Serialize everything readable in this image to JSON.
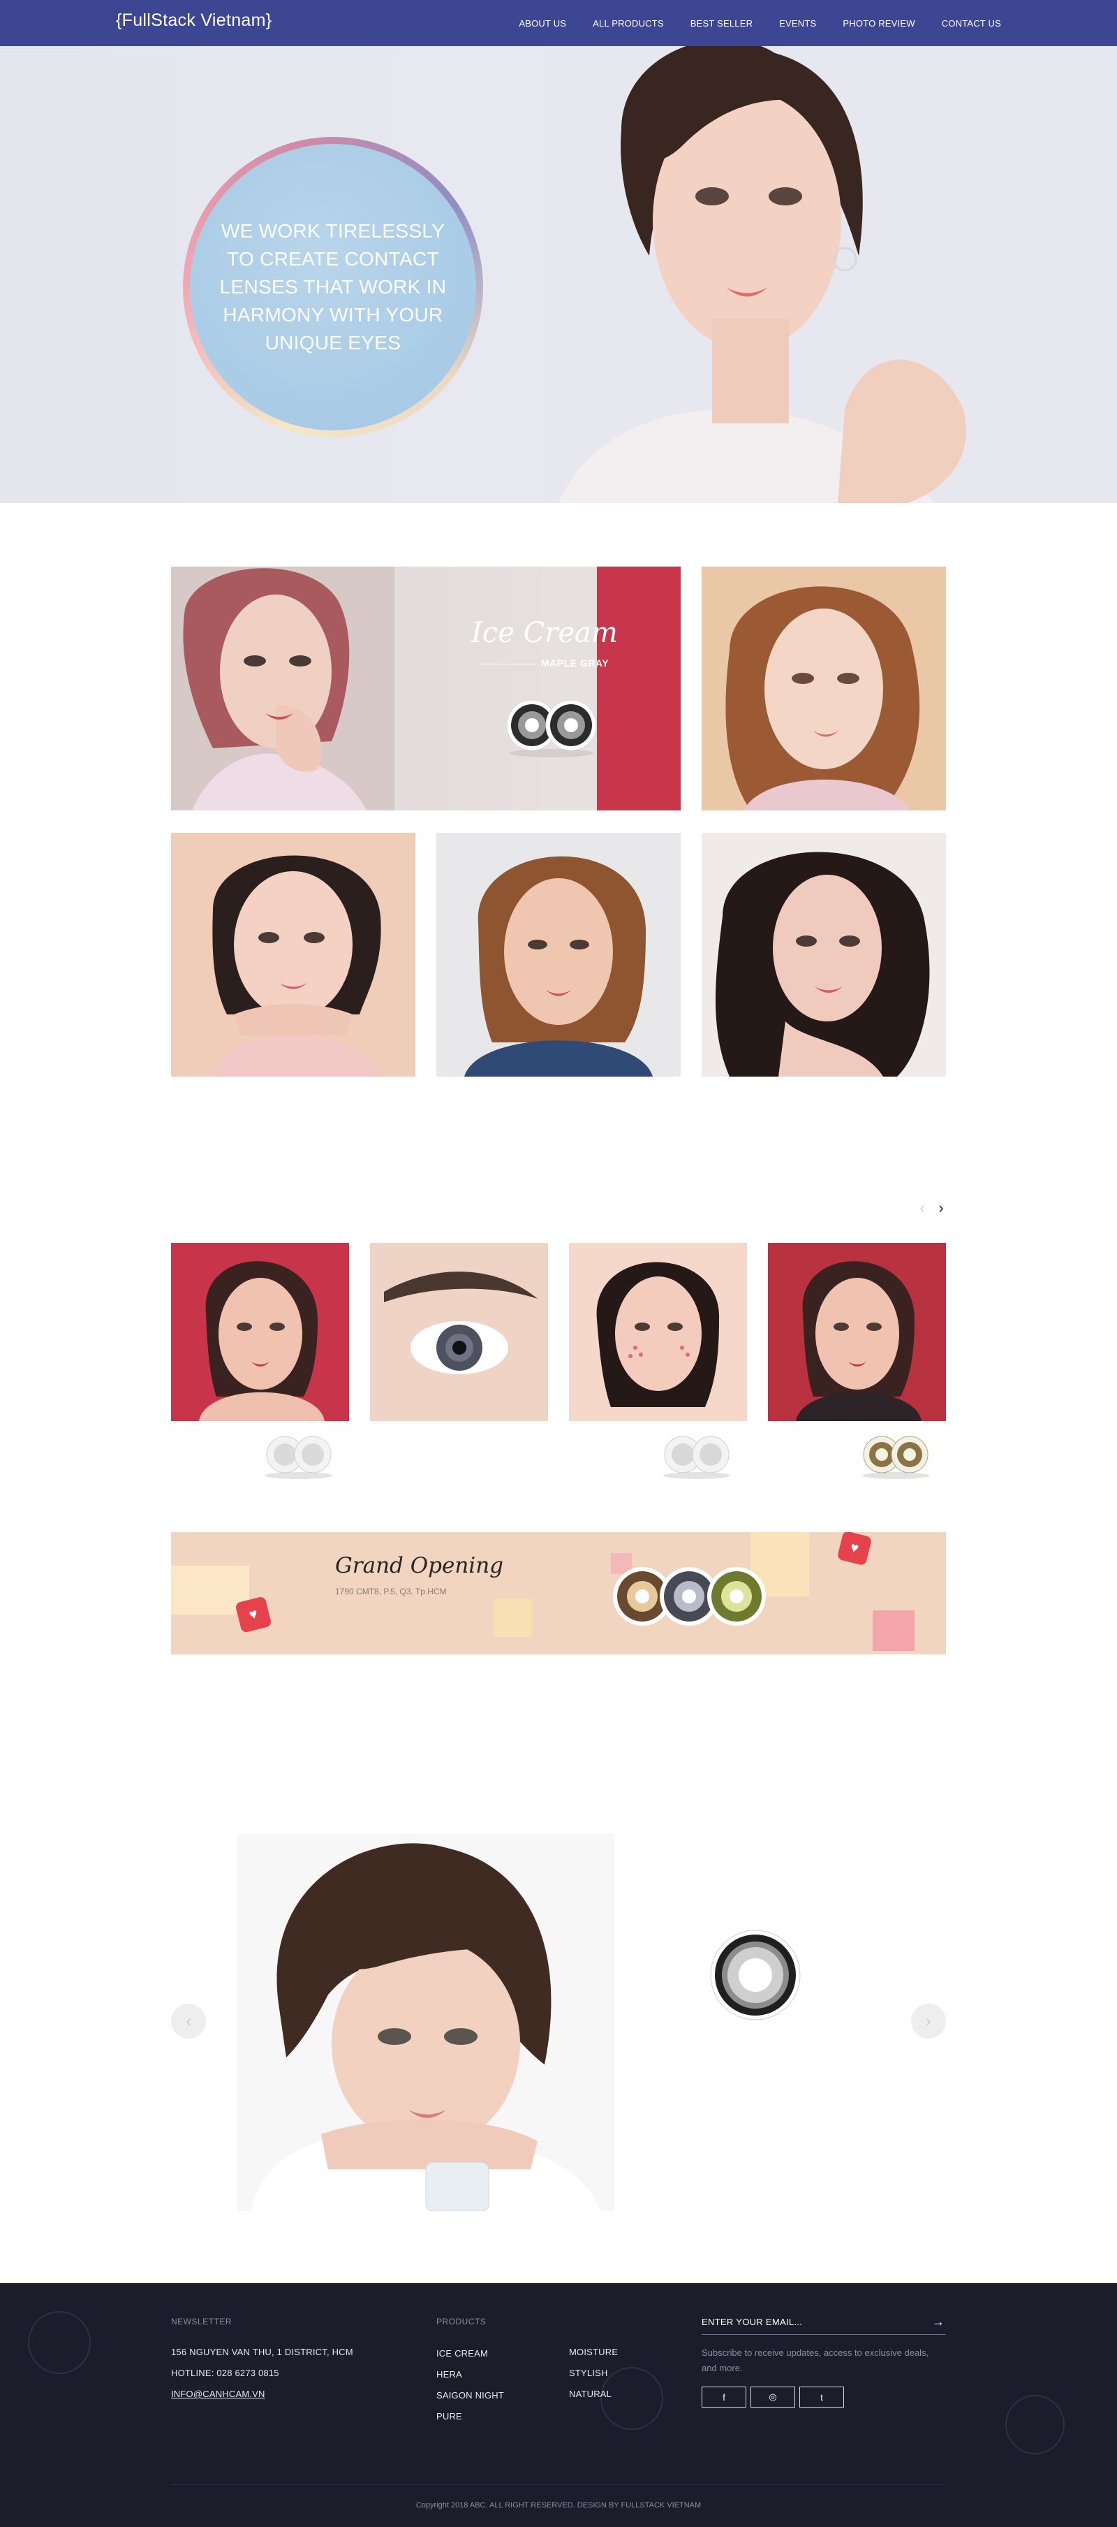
{
  "nav": {
    "logo": "{FullStack Vietnam}",
    "items": [
      "ABOUT US",
      "ALL PRODUCTS",
      "BEST SELLER",
      "EVENTS",
      "PHOTO REVIEW",
      "CONTACT US"
    ]
  },
  "hero": {
    "text": "WE WORK TIRELESSLY TO CREATE CONTACT LENSES THAT WORK IN HARMONY WITH YOUR UNIQUE EYES"
  },
  "feature": {
    "title": "Ice Cream",
    "subtitle": "MAPLE GRAY"
  },
  "banner": {
    "title": "Grand Opening",
    "address": "1790 CMT8, P.5, Q3. Tp.HCM"
  },
  "footer": {
    "newsletter_heading": "NEWSLETTER",
    "address": "156 NGUYEN VAN THU, 1 DISTRICT, HCM",
    "hotline": "HOTLINE: 028 6273 0815",
    "email": "INFO@CANHCAM.VN",
    "products_heading": "PRODUCTS",
    "products_col1": [
      "ICE CREAM",
      "HERA",
      "SAIGON NIGHT",
      "PURE"
    ],
    "products_col2": [
      "MOISTURE",
      "STYLISH",
      "NATURAL"
    ],
    "email_placeholder": "ENTER YOUR EMAIL...",
    "subscribe_text": "Subscribe to receive updates, access to exclusive deals, and more.",
    "social": [
      "f",
      "◎",
      "t"
    ],
    "copyright": "Copyright 2018 ABC. ALL RIGHT RESERVED. DESIGN BY FULLSTACK VIETNAM"
  },
  "colors": {
    "nav": "#3d4693",
    "footer": "#1b1d2a",
    "accent_red": "#c8364c",
    "hero_circle": "#a9cbe6",
    "banner": "#f1d5c0"
  }
}
